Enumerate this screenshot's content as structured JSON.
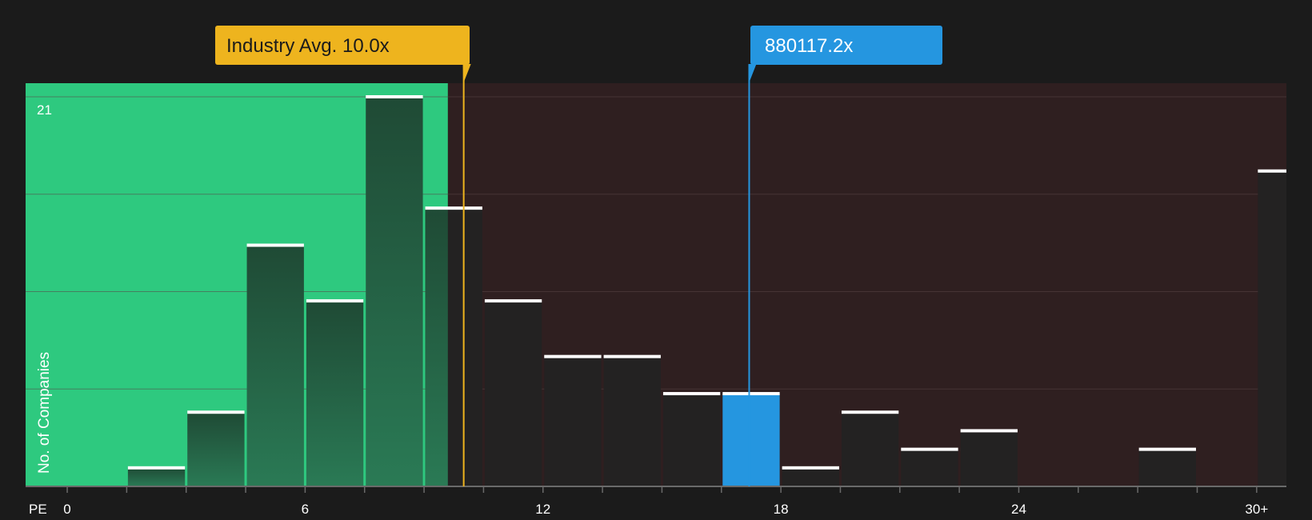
{
  "chart_data": {
    "type": "bar",
    "title": "",
    "xlabel": "PE",
    "ylabel": "No. of Companies",
    "x_tick_labels": [
      "0",
      "6",
      "12",
      "18",
      "24",
      "30+"
    ],
    "x_ticks": [
      0,
      6,
      12,
      18,
      24,
      30
    ],
    "xlim": [
      -1.05,
      30.75
    ],
    "ylim": [
      0,
      21
    ],
    "y_tick_labels": [
      "21"
    ],
    "grid": true,
    "bin_width": 1.5,
    "bins": [
      {
        "start": 1.5,
        "count": 1
      },
      {
        "start": 3.0,
        "count": 4
      },
      {
        "start": 4.5,
        "count": 13
      },
      {
        "start": 6.0,
        "count": 10
      },
      {
        "start": 7.5,
        "count": 21
      },
      {
        "start": 9.0,
        "count": 15
      },
      {
        "start": 10.5,
        "count": 10
      },
      {
        "start": 12.0,
        "count": 7
      },
      {
        "start": 13.5,
        "count": 7
      },
      {
        "start": 15.0,
        "count": 5
      },
      {
        "start": 16.5,
        "count": 5,
        "highlight": true
      },
      {
        "start": 18.0,
        "count": 1
      },
      {
        "start": 19.5,
        "count": 4
      },
      {
        "start": 21.0,
        "count": 2
      },
      {
        "start": 22.5,
        "count": 3
      },
      {
        "start": 27.0,
        "count": 2
      },
      {
        "start": 30.0,
        "count": 17
      }
    ],
    "fair_region_end": 9.6,
    "industry_avg": {
      "label": "Industry Avg. 10.0x",
      "value": 10.0
    },
    "company": {
      "label": "880117.2x",
      "value": 17.2
    }
  },
  "colors": {
    "background": "#1b1b1b",
    "undervalued_zone": "#2ec97f",
    "overvalued_zone": "#2f1f20",
    "bar_dark": "#232222",
    "bar_in_green": "#1f5b3d",
    "highlight_bar": "#2596e0",
    "industry_avg": "#eeb41e",
    "company_marker": "#2596e0",
    "cap_line": "#ffffff",
    "grid_line": "#5a4446",
    "axis_line": "#6a6a6a"
  }
}
